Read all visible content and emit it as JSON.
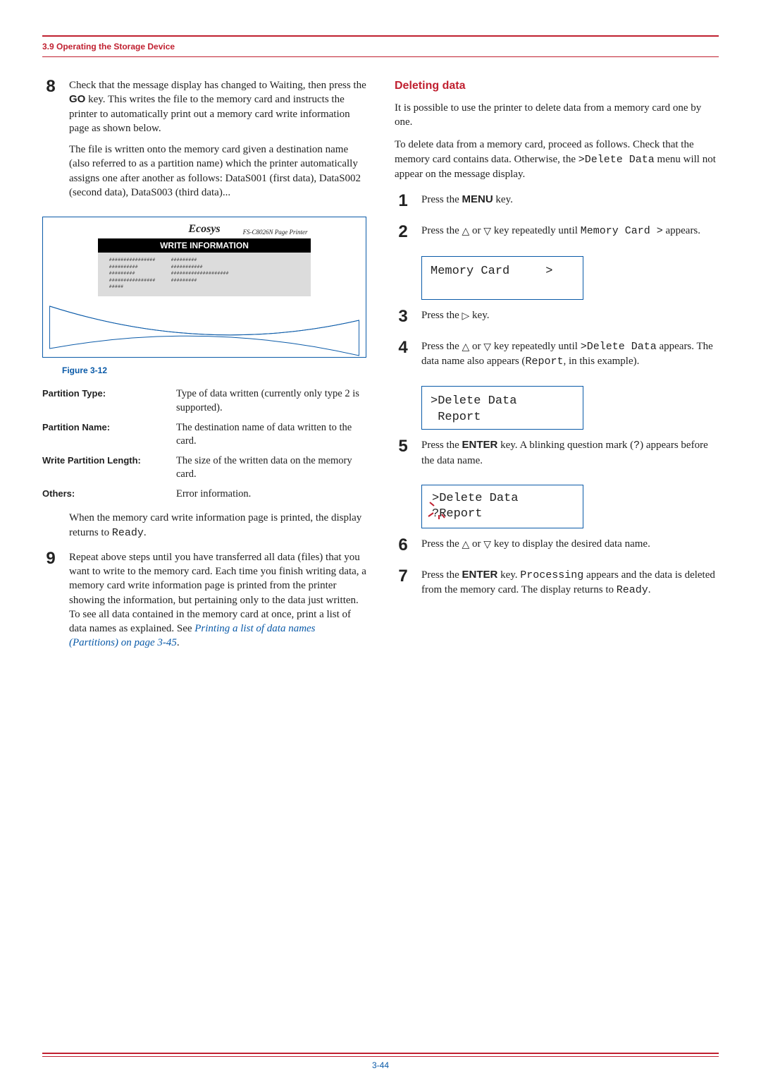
{
  "header": {
    "section_title": "3.9 Operating the Storage Device"
  },
  "left": {
    "step8": {
      "num": "8",
      "p1a": "Check that the message display has changed to Waiting, then press the ",
      "p1b": "GO",
      "p1c": " key. This writes the file to the memory card and instructs the printer to automatically print out a memory card write information page as shown below.",
      "p2": "The file is written onto the memory card given a destination name (also referred to as a partition name) which the printer automatically assigns one after another as follows: DataS001 (first data), DataS002 (second data), DataS003 (third data)..."
    },
    "figure": {
      "ecosys": "Ecosys",
      "subtitle": "FS-C8026N  Page Printer",
      "band": "WRITE INFORMATION",
      "caption": "Figure 3-12"
    },
    "defs": {
      "r1l": "Partition Type:",
      "r1v": "Type of data written (currently only type 2 is supported).",
      "r2l": "Partition Name:",
      "r2v": "The destination name of data written to the card.",
      "r3l": "Write Partition Length:",
      "r3v": "The size of the written data on the memory card.",
      "r4l": "Others:",
      "r4v": "Error information."
    },
    "after_defs_a": "When the memory card write information page is printed, the display returns to ",
    "after_defs_b": "Ready",
    "after_defs_c": ".",
    "step9": {
      "num": "9",
      "p1": "Repeat above steps until you have transferred all data (files) that you want to write to the memory card. Each time you finish writing data, a memory card write information page is printed from the printer showing the information, but pertaining only to the data just written. To see all data contained in the memory card at once, print a list of data names as explained. See ",
      "link": "Printing a list of data names (Partitions) on page 3-45",
      "p1end": "."
    }
  },
  "right": {
    "heading": "Deleting data",
    "intro": "It is possible to use the printer to delete data from a memory card one by one.",
    "intro2a": "To delete data from a memory card, proceed as follows. Check that the memory card contains data. Otherwise, the ",
    "intro2b": ">Delete Data",
    "intro2c": " menu will not appear on the message display.",
    "s1": {
      "num": "1",
      "a": "Press the ",
      "b": "MENU",
      "c": " key."
    },
    "s2": {
      "num": "2",
      "a": "Press the ",
      "b": " or ",
      "c": " key repeatedly until ",
      "d": "Memory Card >",
      "e": " appears."
    },
    "lcd1": "Memory Card     >",
    "s3": {
      "num": "3",
      "a": "Press the ",
      "c": " key."
    },
    "s4": {
      "num": "4",
      "a": "Press the ",
      "b": " or ",
      "c": " key repeatedly until ",
      "d": ">Delete Data",
      "e": " appears. The data name also appears (",
      "f": "Report",
      "g": ", in this example)."
    },
    "lcd2": ">Delete Data\n Report",
    "s5": {
      "num": "5",
      "a": "Press the ",
      "b": "ENTER",
      "c": " key. A blinking question mark (",
      "d": "?",
      "e": ") appears before the data name."
    },
    "lcd3_line1": ">Delete Data",
    "lcd3_line2": "?Report",
    "s6": {
      "num": "6",
      "a": "Press the ",
      "b": " or ",
      "c": " key to display the desired data name."
    },
    "s7": {
      "num": "7",
      "a": "Press the ",
      "b": "ENTER",
      "c": " key. ",
      "d": "Processing",
      "e": " appears and the data is deleted from the memory card. The display returns to ",
      "f": "Ready",
      "g": "."
    }
  },
  "footer": {
    "page": "3-44"
  }
}
